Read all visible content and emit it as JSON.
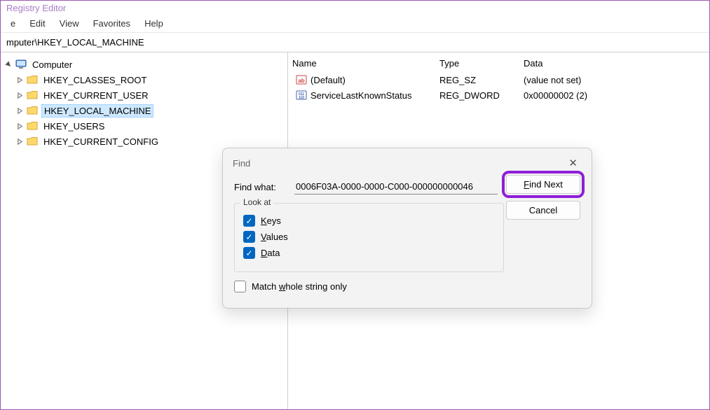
{
  "window": {
    "title": "Registry Editor"
  },
  "menu": {
    "items": [
      "e",
      "Edit",
      "View",
      "Favorites",
      "Help"
    ]
  },
  "address": {
    "path": "mputer\\HKEY_LOCAL_MACHINE"
  },
  "tree": {
    "root": "Computer",
    "keys": [
      {
        "name": "HKEY_CLASSES_ROOT",
        "selected": false
      },
      {
        "name": "HKEY_CURRENT_USER",
        "selected": false
      },
      {
        "name": "HKEY_LOCAL_MACHINE",
        "selected": true
      },
      {
        "name": "HKEY_USERS",
        "selected": false
      },
      {
        "name": "HKEY_CURRENT_CONFIG",
        "selected": false
      }
    ]
  },
  "list": {
    "columns": {
      "name": "Name",
      "type": "Type",
      "data": "Data"
    },
    "rows": [
      {
        "icon": "string",
        "name": "(Default)",
        "type": "REG_SZ",
        "data": "(value not set)"
      },
      {
        "icon": "binary",
        "name": "ServiceLastKnownStatus",
        "type": "REG_DWORD",
        "data": "0x00000002 (2)"
      }
    ]
  },
  "dialog": {
    "title": "Find",
    "findWhatLabel": "Find what:",
    "findWhatValue": "0006F03A-0000-0000-C000-000000000046",
    "lookAtLabel": "Look at",
    "keysLabel": "Keys",
    "valuesLabel": "Values",
    "dataLabel": "Data",
    "matchWholeLabel": "Match whole string only",
    "findNext": "Find Next",
    "cancel": "Cancel"
  }
}
